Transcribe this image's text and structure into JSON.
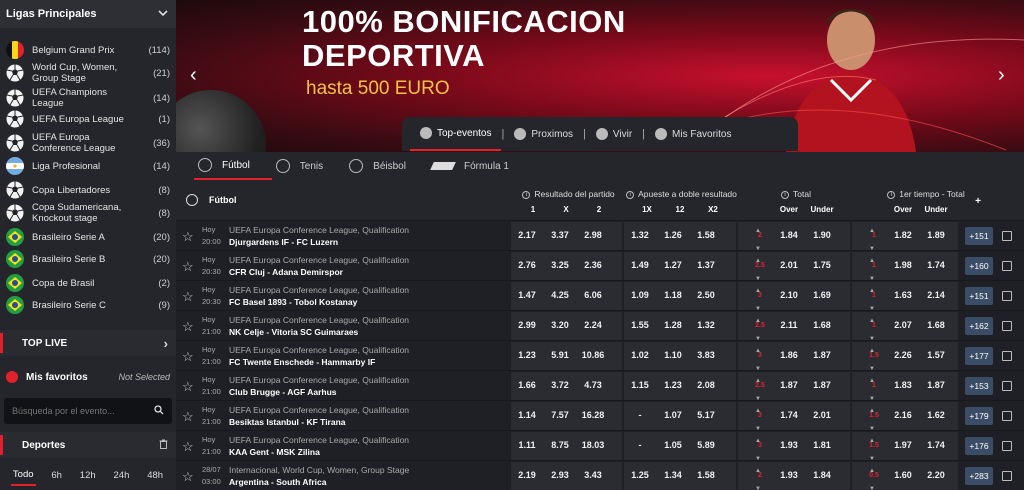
{
  "sidebar": {
    "header": "Ligas Principales",
    "leagues": [
      {
        "name": "Belgium Grand Prix",
        "count": "(114)",
        "flag": "belgium"
      },
      {
        "name": "World Cup, Women, Group Stage",
        "count": "(21)",
        "flag": "world"
      },
      {
        "name": "UEFA Champions League",
        "count": "(14)",
        "flag": "world"
      },
      {
        "name": "UEFA Europa League",
        "count": "(1)",
        "flag": "world"
      },
      {
        "name": "UEFA Europa Conference League",
        "count": "(36)",
        "flag": "world"
      },
      {
        "name": "Liga Profesional",
        "count": "(14)",
        "flag": "argentina"
      },
      {
        "name": "Copa Libertadores",
        "count": "(8)",
        "flag": "world"
      },
      {
        "name": "Copa Sudamericana, Knockout stage",
        "count": "(8)",
        "flag": "world"
      },
      {
        "name": "Brasileiro Serie A",
        "count": "(20)",
        "flag": "brazil"
      },
      {
        "name": "Brasileiro Serie B",
        "count": "(20)",
        "flag": "brazil"
      },
      {
        "name": "Copa de Brasil",
        "count": "(2)",
        "flag": "brazil"
      },
      {
        "name": "Brasileiro Serie C",
        "count": "(9)",
        "flag": "brazil"
      }
    ],
    "top_live": "TOP LIVE",
    "favorites": "Mis favoritos",
    "favorites_status": "Not Selected",
    "search_placeholder": "Búsqueda por el evento...",
    "sports_label": "Deportes",
    "time_tabs": [
      "Todo",
      "6h",
      "12h",
      "24h",
      "48h"
    ]
  },
  "banner": {
    "title_line1": "100% BONIFICACION",
    "title_line2": "DEPORTIVA",
    "subtitle": "hasta 500 EURO",
    "tabs": [
      "Top-eventos",
      "Proximos",
      "Vivir",
      "Mis Favoritos"
    ]
  },
  "sports": [
    "Fútbol",
    "Tenis",
    "Béisbol",
    "Fórmula 1"
  ],
  "table": {
    "sport_label": "Fútbol",
    "groups": {
      "result": "Resultado del partido",
      "double": "Apueste a doble resultado",
      "total": "Total",
      "first_half": "1er tiempo - Total"
    },
    "subheaders": {
      "r1": "1",
      "rx": "X",
      "r2": "2",
      "d1x": "1X",
      "d12": "12",
      "dx2": "X2",
      "over": "Over",
      "under": "Under",
      "over2": "Over",
      "under2": "Under",
      "plus": "+"
    },
    "rows": [
      {
        "day": "Hoy",
        "time": "20:00",
        "league": "UEFA Europa Conference League, Qualification",
        "teams": "Djurgardens IF  -  FC Luzern",
        "odds": [
          "2.17",
          "3.37",
          "2.98",
          "1.32",
          "1.26",
          "1.58"
        ],
        "total_line": "2",
        "over": "1.84",
        "under": "1.90",
        "h_line": "1",
        "h_over": "1.82",
        "h_under": "1.89",
        "more": "+151"
      },
      {
        "day": "Hoy",
        "time": "20:30",
        "league": "UEFA Europa Conference League, Qualification",
        "teams": "CFR Cluj  -  Adana Demirspor",
        "odds": [
          "2.76",
          "3.25",
          "2.36",
          "1.49",
          "1.27",
          "1.37"
        ],
        "total_line": "2.5",
        "over": "2.01",
        "under": "1.75",
        "h_line": "1",
        "h_over": "1.98",
        "h_under": "1.74",
        "more": "+160"
      },
      {
        "day": "Hoy",
        "time": "20:30",
        "league": "UEFA Europa Conference League, Qualification",
        "teams": "FC Basel 1893  -  Tobol Kostanay",
        "odds": [
          "1.47",
          "4.25",
          "6.06",
          "1.09",
          "1.18",
          "2.50"
        ],
        "total_line": "3",
        "over": "2.10",
        "under": "1.69",
        "h_line": "1",
        "h_over": "1.63",
        "h_under": "2.14",
        "more": "+151"
      },
      {
        "day": "Hoy",
        "time": "21:00",
        "league": "UEFA Europa Conference League, Qualification",
        "teams": "NK Celje  -  Vitoria SC Guimaraes",
        "odds": [
          "2.99",
          "3.20",
          "2.24",
          "1.55",
          "1.28",
          "1.32"
        ],
        "total_line": "2.5",
        "over": "2.11",
        "under": "1.68",
        "h_line": "1",
        "h_over": "2.07",
        "h_under": "1.68",
        "more": "+162"
      },
      {
        "day": "Hoy",
        "time": "21:00",
        "league": "UEFA Europa Conference League, Qualification",
        "teams": "FC Twente Enschede  -  Hammarby IF",
        "odds": [
          "1.23",
          "5.91",
          "10.86",
          "1.02",
          "1.10",
          "3.83"
        ],
        "total_line": "3",
        "over": "1.86",
        "under": "1.87",
        "h_line": "1.5",
        "h_over": "2.26",
        "h_under": "1.57",
        "more": "+177"
      },
      {
        "day": "Hoy",
        "time": "21:00",
        "league": "UEFA Europa Conference League, Qualification",
        "teams": "Club Brugge  -  AGF Aarhus",
        "odds": [
          "1.66",
          "3.72",
          "4.73",
          "1.15",
          "1.23",
          "2.08"
        ],
        "total_line": "2.5",
        "over": "1.87",
        "under": "1.87",
        "h_line": "1",
        "h_over": "1.83",
        "h_under": "1.87",
        "more": "+153"
      },
      {
        "day": "Hoy",
        "time": "21:00",
        "league": "UEFA Europa Conference League, Qualification",
        "teams": "Besiktas Istanbul  -  KF Tirana",
        "odds": [
          "1.14",
          "7.57",
          "16.28",
          "-",
          "1.07",
          "5.17"
        ],
        "total_line": "3",
        "over": "1.74",
        "under": "2.01",
        "h_line": "1.5",
        "h_over": "2.16",
        "h_under": "1.62",
        "more": "+179"
      },
      {
        "day": "Hoy",
        "time": "21:00",
        "league": "UEFA Europa Conference League, Qualification",
        "teams": "KAA Gent  -  MSK Zilina",
        "odds": [
          "1.11",
          "8.75",
          "18.03",
          "-",
          "1.05",
          "5.89"
        ],
        "total_line": "3",
        "over": "1.93",
        "under": "1.81",
        "h_line": "1.5",
        "h_over": "1.97",
        "h_under": "1.74",
        "more": "+176"
      },
      {
        "day": "28/07",
        "time": "03:00",
        "league": "Internacional, World Cup, Women, Group Stage",
        "teams": "Argentina  -  South Africa",
        "odds": [
          "2.19",
          "2.93",
          "3.43",
          "1.25",
          "1.34",
          "1.58"
        ],
        "total_line": "2",
        "over": "1.93",
        "under": "1.84",
        "h_line": "0.5",
        "h_over": "1.60",
        "h_under": "2.20",
        "more": "+283"
      }
    ]
  },
  "colors": {
    "accent": "#e3212c",
    "bg": "#1b1c20",
    "panel": "#25262b",
    "odds_cell": "#2b2c32",
    "more": "#3b4d66",
    "gold": "#f5c242"
  }
}
